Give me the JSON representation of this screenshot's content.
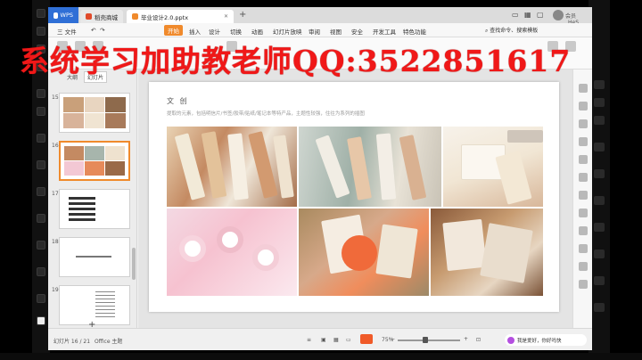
{
  "tabs": {
    "wps": "WPS",
    "mall": "稻壳商城",
    "doc": "毕业设计2.0.pptx"
  },
  "menu": {
    "file": "三 文件",
    "start": "开始",
    "insert": "插入",
    "design": "设计",
    "switch": "切换",
    "animation": "动画",
    "slideshow": "幻灯片放映",
    "review": "审阅",
    "view": "视图",
    "security": "安全",
    "dev": "开发工具",
    "special": "特色功能",
    "search": "查找命令、搜索模板"
  },
  "user": "会员_HeS...",
  "watermark": "系统学习加助教老师QQ:3522851617",
  "left_panel": {
    "tabs": [
      "大纲",
      "幻灯片"
    ],
    "slides": [
      {
        "num": "15"
      },
      {
        "num": "16"
      },
      {
        "num": "17"
      },
      {
        "num": "18"
      },
      {
        "num": "19"
      }
    ]
  },
  "slide": {
    "title": "文 创",
    "description": "提取的元素，包括明信片/书签/胶带/贴纸/笔记本等特产品，主题性较强，住往为系列的插图"
  },
  "status": {
    "page": "幻灯片 16 / 21",
    "theme": "Office 主题",
    "zoom": "75%",
    "widget": "我是爱好，你好吗快"
  },
  "colors": {
    "accent": "#f08a2c",
    "wps_blue": "#2f6fd6",
    "watermark_red": "#f01818"
  }
}
